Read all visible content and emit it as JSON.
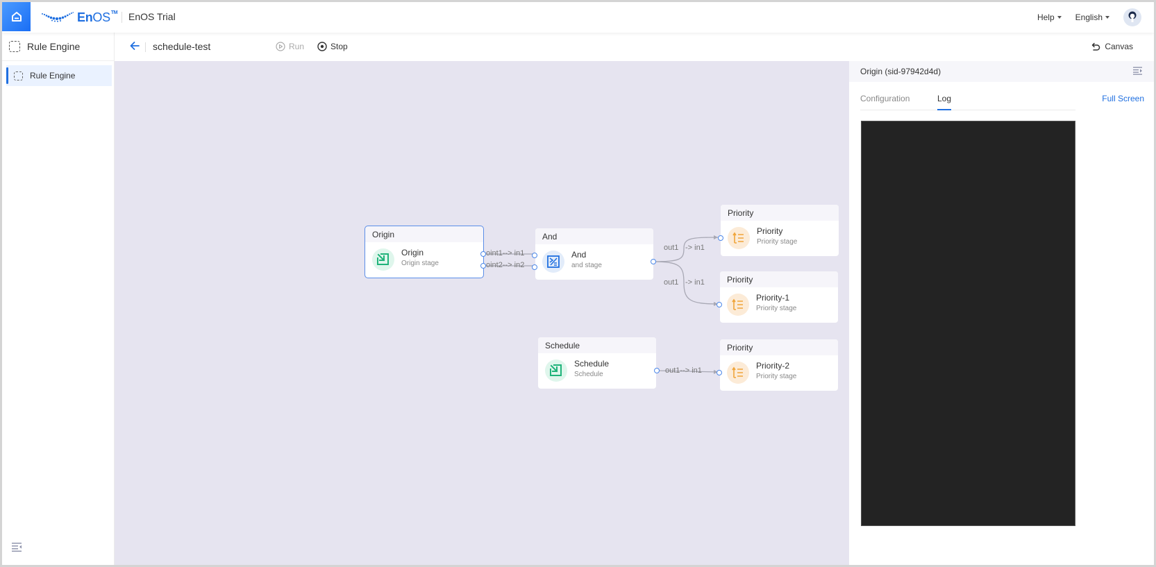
{
  "topbar": {
    "logo_text_bold": "En",
    "logo_text_rest": "OS",
    "logo_tm": "TM",
    "app_name": "EnOS Trial",
    "help_label": "Help",
    "language_label": "English"
  },
  "sidebar": {
    "header_label": "Rule Engine",
    "items": [
      {
        "label": "Rule Engine",
        "active": true
      }
    ]
  },
  "toolbar": {
    "flow_name": "schedule-test",
    "run_label": "Run",
    "stop_label": "Stop",
    "canvas_label": "Canvas"
  },
  "canvas": {
    "nodes": [
      {
        "id": "origin",
        "header": "Origin",
        "name": "Origin",
        "subtitle": "Origin stage",
        "icon": "input-arrow-icon",
        "selected": true
      },
      {
        "id": "and",
        "header": "And",
        "name": "And",
        "subtitle": "and stage",
        "icon": "and-logic-icon",
        "selected": false
      },
      {
        "id": "priority",
        "header": "Priority",
        "name": "Priority",
        "subtitle": "Priority stage",
        "icon": "priority-list-icon",
        "selected": false
      },
      {
        "id": "priority1",
        "header": "Priority",
        "name": "Priority-1",
        "subtitle": "Priority stage",
        "icon": "priority-list-icon",
        "selected": false
      },
      {
        "id": "schedule",
        "header": "Schedule",
        "name": "Schedule",
        "subtitle": "Schedule",
        "icon": "input-arrow-icon",
        "selected": false
      },
      {
        "id": "priority2",
        "header": "Priority",
        "name": "Priority-2",
        "subtitle": "Priority stage",
        "icon": "priority-list-icon",
        "selected": false
      }
    ],
    "edges": [
      {
        "from": "origin",
        "to": "and",
        "label": "oint1--> in1"
      },
      {
        "from": "origin",
        "to": "and",
        "label": "oint2--> in2"
      },
      {
        "from": "and",
        "to": "priority",
        "label_from": "out1",
        "label_to": "-> in1"
      },
      {
        "from": "and",
        "to": "priority1",
        "label_from": "out1",
        "label_to": "-> in1"
      },
      {
        "from": "schedule",
        "to": "priority2",
        "label": "out1--> in1"
      }
    ]
  },
  "panel": {
    "title": "Origin (sid-97942d4d)",
    "tabs": [
      {
        "label": "Configuration",
        "active": false
      },
      {
        "label": "Log",
        "active": true
      }
    ],
    "fullscreen_label": "Full Screen",
    "log_content": ""
  },
  "colors": {
    "accent": "#1f6fe0",
    "canvas_bg": "#e6e4f0",
    "log_bg": "#232323",
    "green_icon": "#1fb37a",
    "blue_icon": "#1f6fe0",
    "orange_icon": "#f0a53a"
  }
}
